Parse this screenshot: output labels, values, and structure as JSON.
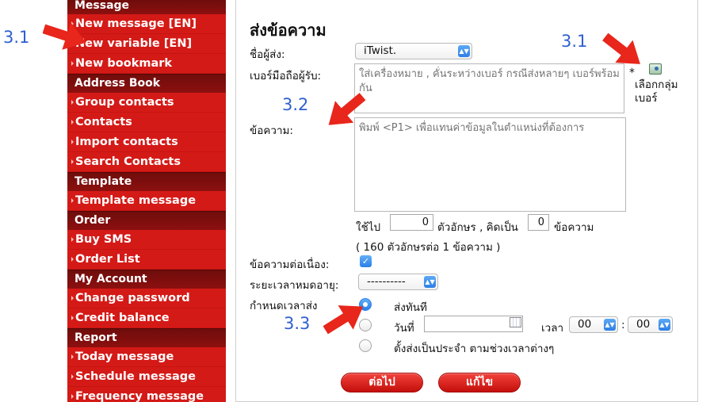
{
  "sidebar": {
    "sections": [
      {
        "title": "Message",
        "items": [
          "New message [EN]",
          "New variable [EN]",
          "New bookmark"
        ]
      },
      {
        "title": "Address Book",
        "items": [
          "Group contacts",
          "Contacts",
          "Import contacts",
          "Search Contacts"
        ]
      },
      {
        "title": "Template",
        "items": [
          "Template message"
        ]
      },
      {
        "title": "Order",
        "items": [
          "Buy SMS",
          "Order List"
        ]
      },
      {
        "title": "My Account",
        "items": [
          "Change password",
          "Credit balance"
        ]
      },
      {
        "title": "Report",
        "items": [
          "Today message",
          "Schedule message",
          "Frequency message"
        ]
      }
    ]
  },
  "form": {
    "title": "ส่งข้อความ",
    "sender_label": "ชื่อผู้ส่ง:",
    "sender_value": "iTwist.",
    "recipient_label": "เบอร์มือถือผู้รับ:",
    "recipient_placeholder": "ใส่เครื่องหมาย , คั่นระหว่างเบอร์ กรณีส่งหลายๆ เบอร์พร้อมกัน",
    "required_mark": "*",
    "group_select_label": "เลือกกลุ่ม เบอร์",
    "message_label": "ข้อความ:",
    "message_placeholder": "พิมพ์ <P1> เพื่อแทนค่าข้อมูลในตำแหน่งที่ต้องการ",
    "used_label": "ใช้ไป",
    "chars_value": "0",
    "chars_label": "ตัวอักษร , คิดเป็น",
    "msg_count_value": "0",
    "msg_count_label": "ข้อความ",
    "per_message_note": "( 160 ตัวอักษรต่อ 1 ข้อความ )",
    "continuous_label": "ข้อความต่อเนื่อง:",
    "expiry_label": "ระยะเวลาหมดอายุ:",
    "expiry_value": "----------",
    "schedule_label": "กำหนดเวลาส่ง",
    "send_now_label": "ส่งทันที",
    "date_label": "วันที่",
    "time_label": "เวลา",
    "hour_value": "00",
    "time_sep": ":",
    "minute_value": "00",
    "recurring_label": "ตั้งส่งเป็นประจำ ตามช่วงเวลาต่างๆ",
    "next_button": "ต่อไป",
    "edit_button": "แก้ไข"
  },
  "annotations": {
    "a1": "3.1",
    "a2": "3.1",
    "a3": "3.2",
    "a4": "3.3",
    "color": "#2f5fd0"
  },
  "colors": {
    "sidebar_bg": "#d41a17",
    "section_header_bg": "#7a0e0d",
    "accent_blue": "#2a7ee8",
    "arrow_red": "#e8261b"
  }
}
